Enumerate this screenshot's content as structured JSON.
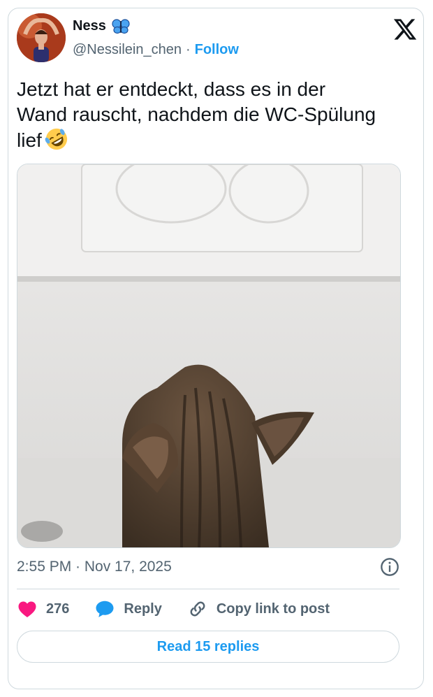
{
  "author": {
    "name": "Ness",
    "handle": "@Nessilein_chen",
    "separator": "·",
    "follow_label": "Follow",
    "avatar_icon": "avatar-photo",
    "badge_icon": "butterfly-emoji"
  },
  "tweet": {
    "text": "Jetzt hat er entdeckt, dass es in der\nWand rauscht, nachdem die WC-Spülung\nlief",
    "emoji_icon": "rolling-on-floor-laughing-emoji",
    "media_description_icon": "cat-photo"
  },
  "meta": {
    "timestamp": "2:55 PM · Nov 17, 2025"
  },
  "actions": {
    "likes": "276",
    "reply_label": "Reply",
    "copy_label": "Copy link to post"
  },
  "read_replies_label": "Read 15 replies",
  "colors": {
    "accent": "#1d9bf0",
    "heart": "#f91880",
    "text": "#0f1419",
    "muted": "#536471",
    "border": "#cfd9de"
  }
}
